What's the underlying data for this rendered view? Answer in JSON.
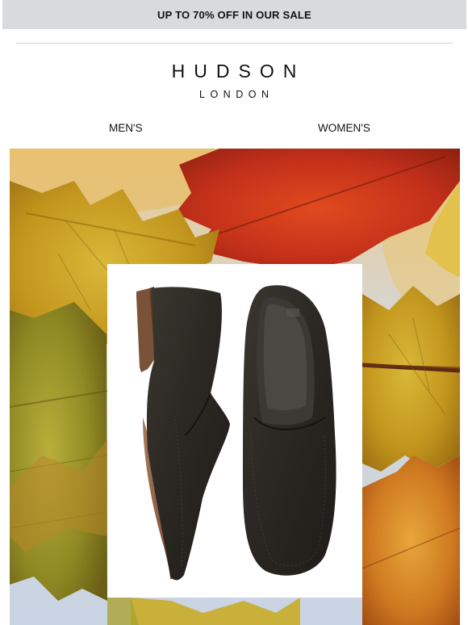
{
  "promo": {
    "text": "UP TO 70% OFF IN OUR SALE"
  },
  "brand": {
    "name": "HUDSON",
    "city": "LONDON"
  },
  "nav": {
    "items": [
      {
        "label": "MEN'S"
      },
      {
        "label": "WOMEN'S"
      }
    ]
  },
  "hero": {
    "background": "autumn-leaves",
    "product": "dark-brown-suede-loafers"
  },
  "colors": {
    "promo_bar": "#d9dadc",
    "text": "#111111",
    "leaf_yellow": "#c9a321",
    "leaf_red": "#c7321a",
    "sky": "#cfd8e6",
    "suede": "#2c2924"
  }
}
